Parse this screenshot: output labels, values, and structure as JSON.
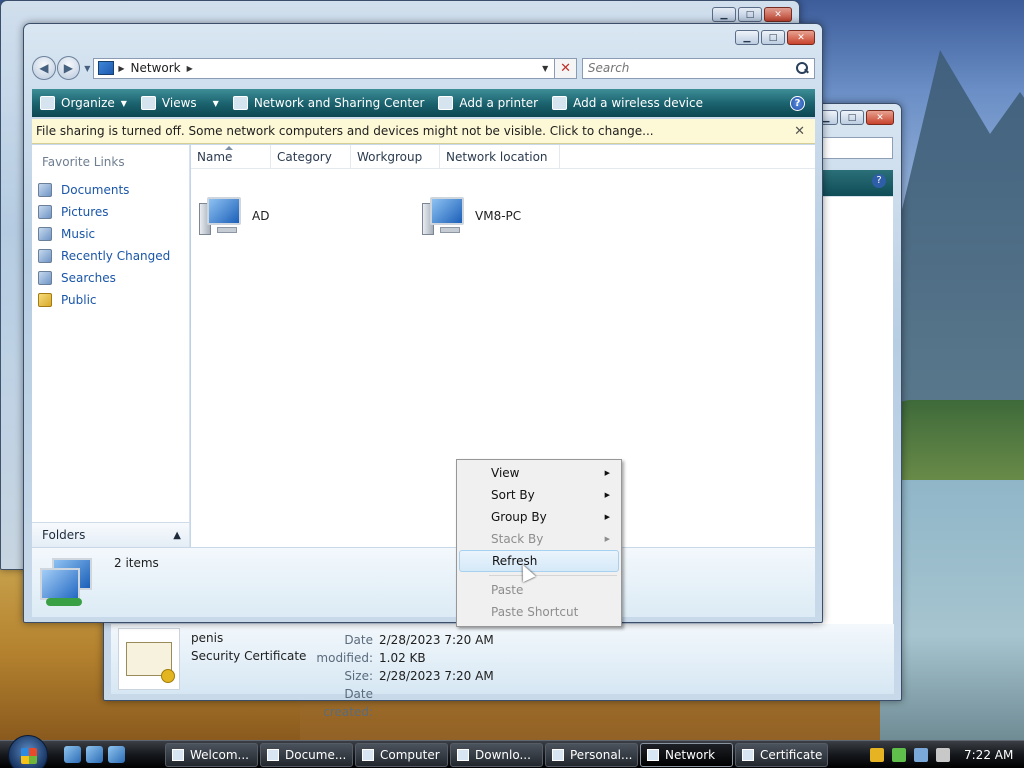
{
  "main_window": {
    "address": "Network",
    "search_placeholder": "Search",
    "commands": [
      {
        "label": "Organize",
        "dropdown": true
      },
      {
        "label": "Views",
        "dropdown": true
      },
      {
        "label": "Network and Sharing Center",
        "dropdown": false
      },
      {
        "label": "Add a printer",
        "dropdown": false
      },
      {
        "label": "Add a wireless device",
        "dropdown": false
      }
    ],
    "help_glyph": "?",
    "infobar": "File sharing is turned off. Some network computers and devices might not be visible. Click to change...",
    "sidebar": {
      "title": "Favorite Links",
      "links": [
        "Documents",
        "Pictures",
        "Music",
        "Recently Changed",
        "Searches",
        "Public"
      ],
      "folders_label": "Folders"
    },
    "columns": [
      "Name",
      "Category",
      "Workgroup",
      "Network location"
    ],
    "items": [
      "AD",
      "VM8-PC"
    ],
    "status_count": "2 items"
  },
  "background_window": {
    "help_glyph": "?",
    "file_name": "penis",
    "file_type": "Security Certificate",
    "labels": {
      "modified": "Date modified:",
      "size": "Size:",
      "created": "Date created:"
    },
    "values": {
      "modified": "2/28/2023 7:20 AM",
      "size": "1.02 KB",
      "created": "2/28/2023 7:20 AM"
    }
  },
  "context_menu": {
    "items": [
      {
        "label": "View",
        "submenu": true,
        "disabled": false
      },
      {
        "label": "Sort By",
        "submenu": true,
        "disabled": false
      },
      {
        "label": "Group By",
        "submenu": true,
        "disabled": false
      },
      {
        "label": "Stack By",
        "submenu": true,
        "disabled": true
      },
      {
        "label": "Refresh",
        "submenu": false,
        "disabled": false,
        "highlighted": true
      },
      {
        "label": "Paste",
        "submenu": false,
        "disabled": true
      },
      {
        "label": "Paste Shortcut",
        "submenu": false,
        "disabled": true
      }
    ]
  },
  "taskbar": {
    "tasks": [
      "Welcom...",
      "Docume...",
      "Computer",
      "Downlo...",
      "Personal...",
      "Network",
      "Certificate"
    ],
    "active_task": "Network",
    "clock": "7:22 AM"
  },
  "colors": {
    "command_bar": "#1c6470",
    "infobar": "#fdf9d6",
    "link": "#1a56a8"
  }
}
